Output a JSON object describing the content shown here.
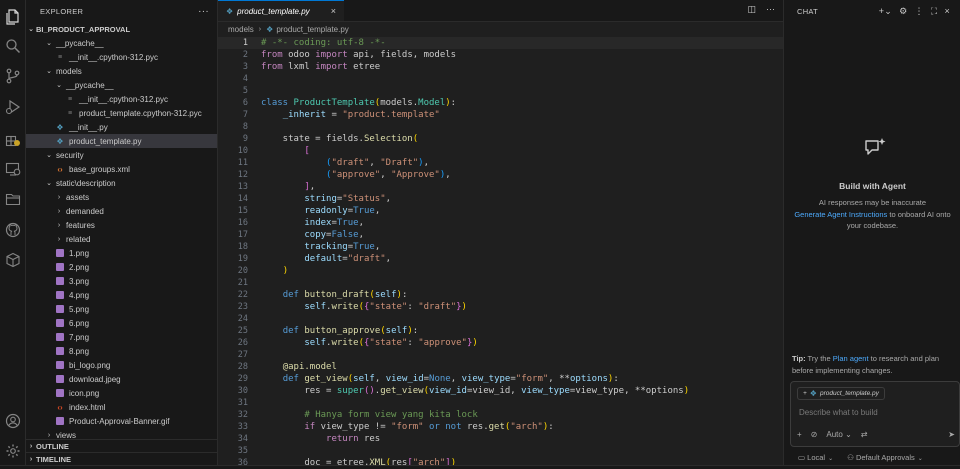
{
  "explorer": {
    "title": "EXPLORER",
    "more": "···",
    "project": "BI_PRODUCT_APPROVAL",
    "tree": [
      {
        "label": "__pycache__",
        "depth": 1,
        "type": "folder-open"
      },
      {
        "label": "__init__.cpython-312.pyc",
        "depth": 2,
        "type": "file"
      },
      {
        "label": "models",
        "depth": 1,
        "type": "folder-open"
      },
      {
        "label": "__pycache__",
        "depth": 2,
        "type": "folder-open"
      },
      {
        "label": "__init__.cpython-312.pyc",
        "depth": 3,
        "type": "file"
      },
      {
        "label": "product_template.cpython-312.pyc",
        "depth": 3,
        "type": "file"
      },
      {
        "label": "__init__.py",
        "depth": 2,
        "type": "py"
      },
      {
        "label": "product_template.py",
        "depth": 2,
        "type": "py",
        "selected": true
      },
      {
        "label": "security",
        "depth": 1,
        "type": "folder-open"
      },
      {
        "label": "base_groups.xml",
        "depth": 2,
        "type": "xml"
      },
      {
        "label": "static\\description",
        "depth": 1,
        "type": "folder-open"
      },
      {
        "label": "assets",
        "depth": 2,
        "type": "folder"
      },
      {
        "label": "demanded",
        "depth": 2,
        "type": "folder"
      },
      {
        "label": "features",
        "depth": 2,
        "type": "folder"
      },
      {
        "label": "related",
        "depth": 2,
        "type": "folder"
      },
      {
        "label": "1.png",
        "depth": 2,
        "type": "img"
      },
      {
        "label": "2.png",
        "depth": 2,
        "type": "img"
      },
      {
        "label": "3.png",
        "depth": 2,
        "type": "img"
      },
      {
        "label": "4.png",
        "depth": 2,
        "type": "img"
      },
      {
        "label": "5.png",
        "depth": 2,
        "type": "img"
      },
      {
        "label": "6.png",
        "depth": 2,
        "type": "img"
      },
      {
        "label": "7.png",
        "depth": 2,
        "type": "img"
      },
      {
        "label": "8.png",
        "depth": 2,
        "type": "img"
      },
      {
        "label": "bi_logo.png",
        "depth": 2,
        "type": "img"
      },
      {
        "label": "download.jpeg",
        "depth": 2,
        "type": "img"
      },
      {
        "label": "icon.png",
        "depth": 2,
        "type": "img"
      },
      {
        "label": "index.html",
        "depth": 2,
        "type": "html"
      },
      {
        "label": "Product-Approval-Banner.gif",
        "depth": 2,
        "type": "img"
      },
      {
        "label": "views",
        "depth": 1,
        "type": "folder"
      }
    ],
    "outline": "OUTLINE",
    "timeline": "TIMELINE"
  },
  "editor": {
    "tab_label": "product_template.py",
    "breadcrumb": [
      "models",
      "product_template.py"
    ],
    "lines": [
      [
        [
          "cmt",
          "# -*- coding: utf-8 -*-"
        ]
      ],
      [
        [
          "ctl",
          "from"
        ],
        [
          "plain",
          " odoo "
        ],
        [
          "ctl",
          "import"
        ],
        [
          "plain",
          " api, fields, models"
        ]
      ],
      [
        [
          "ctl",
          "from"
        ],
        [
          "plain",
          " lxml "
        ],
        [
          "ctl",
          "import"
        ],
        [
          "plain",
          " etree"
        ]
      ],
      [],
      [],
      [
        [
          "kw",
          "class"
        ],
        [
          "plain",
          " "
        ],
        [
          "cls",
          "ProductTemplate"
        ],
        [
          "brk",
          "("
        ],
        [
          "plain",
          "models."
        ],
        [
          "cls",
          "Model"
        ],
        [
          "brk",
          ")"
        ],
        [
          "plain",
          ":"
        ]
      ],
      [
        [
          "plain",
          "    "
        ],
        [
          "var",
          "_inherit"
        ],
        [
          "plain",
          " = "
        ],
        [
          "str",
          "\"product.template\""
        ]
      ],
      [],
      [
        [
          "plain",
          "    state = fields."
        ],
        [
          "fn",
          "Selection"
        ],
        [
          "brk",
          "("
        ]
      ],
      [
        [
          "plain",
          "        "
        ],
        [
          "brk2",
          "["
        ]
      ],
      [
        [
          "plain",
          "            "
        ],
        [
          "brk3",
          "("
        ],
        [
          "str",
          "\"draft\""
        ],
        [
          "plain",
          ", "
        ],
        [
          "str",
          "\"Draft\""
        ],
        [
          "brk3",
          ")"
        ],
        [
          "plain",
          ","
        ]
      ],
      [
        [
          "plain",
          "            "
        ],
        [
          "brk3",
          "("
        ],
        [
          "str",
          "\"approve\""
        ],
        [
          "plain",
          ", "
        ],
        [
          "str",
          "\"Approve\""
        ],
        [
          "brk3",
          ")"
        ],
        [
          "plain",
          ","
        ]
      ],
      [
        [
          "plain",
          "        "
        ],
        [
          "brk2",
          "]"
        ],
        [
          "plain",
          ","
        ]
      ],
      [
        [
          "plain",
          "        "
        ],
        [
          "var",
          "string"
        ],
        [
          "plain",
          "="
        ],
        [
          "str",
          "\"Status\""
        ],
        [
          "plain",
          ","
        ]
      ],
      [
        [
          "plain",
          "        "
        ],
        [
          "var",
          "readonly"
        ],
        [
          "plain",
          "="
        ],
        [
          "kw",
          "True"
        ],
        [
          "plain",
          ","
        ]
      ],
      [
        [
          "plain",
          "        "
        ],
        [
          "var",
          "index"
        ],
        [
          "plain",
          "="
        ],
        [
          "kw",
          "True"
        ],
        [
          "plain",
          ","
        ]
      ],
      [
        [
          "plain",
          "        "
        ],
        [
          "var",
          "copy"
        ],
        [
          "plain",
          "="
        ],
        [
          "kw",
          "False"
        ],
        [
          "plain",
          ","
        ]
      ],
      [
        [
          "plain",
          "        "
        ],
        [
          "var",
          "tracking"
        ],
        [
          "plain",
          "="
        ],
        [
          "kw",
          "True"
        ],
        [
          "plain",
          ","
        ]
      ],
      [
        [
          "plain",
          "        "
        ],
        [
          "var",
          "default"
        ],
        [
          "plain",
          "="
        ],
        [
          "str",
          "\"draft\""
        ],
        [
          "plain",
          ","
        ]
      ],
      [
        [
          "plain",
          "    "
        ],
        [
          "brk",
          ")"
        ]
      ],
      [],
      [
        [
          "plain",
          "    "
        ],
        [
          "kw",
          "def"
        ],
        [
          "plain",
          " "
        ],
        [
          "fn",
          "button_draft"
        ],
        [
          "brk",
          "("
        ],
        [
          "var",
          "self"
        ],
        [
          "brk",
          ")"
        ],
        [
          "plain",
          ":"
        ]
      ],
      [
        [
          "plain",
          "        "
        ],
        [
          "var",
          "self"
        ],
        [
          "plain",
          "."
        ],
        [
          "fn",
          "write"
        ],
        [
          "brk",
          "("
        ],
        [
          "brk2",
          "{"
        ],
        [
          "str",
          "\"state\""
        ],
        [
          "plain",
          ": "
        ],
        [
          "str",
          "\"draft\""
        ],
        [
          "brk2",
          "}"
        ],
        [
          "brk",
          ")"
        ]
      ],
      [],
      [
        [
          "plain",
          "    "
        ],
        [
          "kw",
          "def"
        ],
        [
          "plain",
          " "
        ],
        [
          "fn",
          "button_approve"
        ],
        [
          "brk",
          "("
        ],
        [
          "var",
          "self"
        ],
        [
          "brk",
          ")"
        ],
        [
          "plain",
          ":"
        ]
      ],
      [
        [
          "plain",
          "        "
        ],
        [
          "var",
          "self"
        ],
        [
          "plain",
          "."
        ],
        [
          "fn",
          "write"
        ],
        [
          "brk",
          "("
        ],
        [
          "brk2",
          "{"
        ],
        [
          "str",
          "\"state\""
        ],
        [
          "plain",
          ": "
        ],
        [
          "str",
          "\"approve\""
        ],
        [
          "brk2",
          "}"
        ],
        [
          "brk",
          ")"
        ]
      ],
      [],
      [
        [
          "plain",
          "    "
        ],
        [
          "deco",
          "@api.model"
        ]
      ],
      [
        [
          "plain",
          "    "
        ],
        [
          "kw",
          "def"
        ],
        [
          "plain",
          " "
        ],
        [
          "fn",
          "get_view"
        ],
        [
          "brk",
          "("
        ],
        [
          "var",
          "self"
        ],
        [
          "plain",
          ", "
        ],
        [
          "var",
          "view_id"
        ],
        [
          "plain",
          "="
        ],
        [
          "kw",
          "None"
        ],
        [
          "plain",
          ", "
        ],
        [
          "var",
          "view_type"
        ],
        [
          "plain",
          "="
        ],
        [
          "str",
          "\"form\""
        ],
        [
          "plain",
          ", **"
        ],
        [
          "var",
          "options"
        ],
        [
          "brk",
          ")"
        ],
        [
          "plain",
          ":"
        ]
      ],
      [
        [
          "plain",
          "        res = "
        ],
        [
          "cls",
          "super"
        ],
        [
          "brk2",
          "()"
        ],
        [
          "plain",
          "."
        ],
        [
          "fn",
          "get_view"
        ],
        [
          "brk",
          "("
        ],
        [
          "var",
          "view_id"
        ],
        [
          "plain",
          "=view_id, "
        ],
        [
          "var",
          "view_type"
        ],
        [
          "plain",
          "=view_type, **options"
        ],
        [
          "brk",
          ")"
        ]
      ],
      [],
      [
        [
          "plain",
          "        "
        ],
        [
          "cmt",
          "# Hanya form view yang kita lock"
        ]
      ],
      [
        [
          "plain",
          "        "
        ],
        [
          "ctl",
          "if"
        ],
        [
          "plain",
          " view_type != "
        ],
        [
          "str",
          "\"form\""
        ],
        [
          "plain",
          " "
        ],
        [
          "kw",
          "or"
        ],
        [
          "plain",
          " "
        ],
        [
          "kw",
          "not"
        ],
        [
          "plain",
          " res."
        ],
        [
          "fn",
          "get"
        ],
        [
          "brk",
          "("
        ],
        [
          "str",
          "\"arch\""
        ],
        [
          "brk",
          ")"
        ],
        [
          "plain",
          ":"
        ]
      ],
      [
        [
          "plain",
          "            "
        ],
        [
          "ctl",
          "return"
        ],
        [
          "plain",
          " res"
        ]
      ],
      [],
      [
        [
          "plain",
          "        doc = etree."
        ],
        [
          "fn",
          "XML"
        ],
        [
          "brk",
          "("
        ],
        [
          "plain",
          "res"
        ],
        [
          "brk2",
          "["
        ],
        [
          "str",
          "\"arch\""
        ],
        [
          "brk2",
          "]"
        ],
        [
          "brk",
          ")"
        ]
      ]
    ],
    "current_line": 1
  },
  "chat": {
    "title": "CHAT",
    "agent_title": "Build with Agent",
    "desc_1": "AI responses may be inaccurate",
    "desc_link": "Generate Agent Instructions",
    "desc_2": " to onboard AI onto your codebase.",
    "tip_label": "Tip:",
    "tip_1": " Try the ",
    "tip_link": "Plan agent",
    "tip_2": " to research and plan before implementing changes.",
    "attachment": "product_template.py",
    "placeholder": "Describe what to build",
    "mode": "Auto",
    "footer_local": "Local",
    "footer_approvals": "Default Approvals"
  }
}
